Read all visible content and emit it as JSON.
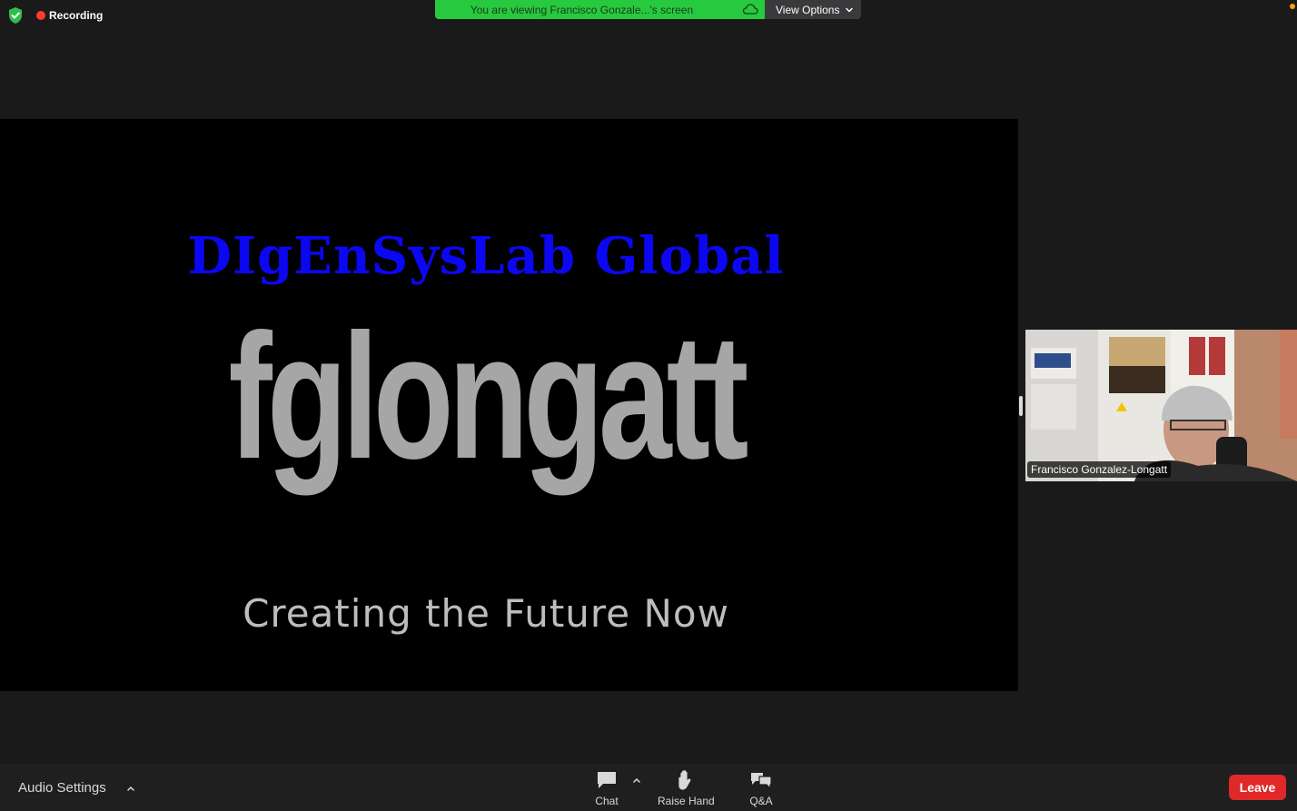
{
  "status": {
    "recording_label": "Recording"
  },
  "banner": {
    "viewing_text": "You are viewing Francisco Gonzale...'s screen",
    "view_options_label": "View Options"
  },
  "slide": {
    "title": "DIgEnSysLab Global",
    "big_text": "fglongatt",
    "tagline": "Creating the Future Now"
  },
  "participant": {
    "name": "Francisco Gonzalez-Longatt"
  },
  "toolbar": {
    "audio_settings_label": "Audio Settings",
    "chat_label": "Chat",
    "raise_hand_label": "Raise Hand",
    "qa_label": "Q&A",
    "leave_label": "Leave"
  },
  "colors": {
    "background": "#1a1a1a",
    "banner_green": "#27c93f",
    "leave_red": "#e02828",
    "slide_title_blue": "#0c07f2",
    "slide_big_gray": "#a6a6a6"
  }
}
